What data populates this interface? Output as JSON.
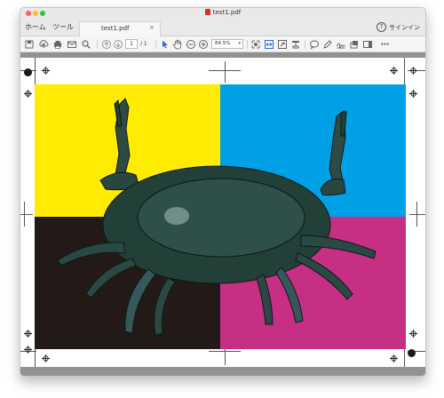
{
  "window": {
    "title": "test1.pdf"
  },
  "tabs": {
    "home": "ホーム",
    "tools": "ツール",
    "document": "test1.pdf",
    "close": "×"
  },
  "header": {
    "help": "?",
    "signin": "サインイン"
  },
  "toolbar": {
    "page_current": "1",
    "page_total": "/ 1",
    "zoom": "84.5%",
    "more": "•••",
    "icons": [
      "save-icon",
      "upload-icon",
      "print-icon",
      "mail-icon",
      "search-icon",
      "prev-page-icon",
      "next-page-icon",
      "pointer-icon",
      "hand-icon",
      "zoom-out-icon",
      "zoom-in-icon",
      "fit-page-icon",
      "fit-width-icon",
      "fullscreen-icon",
      "stamp-icon",
      "comment-icon",
      "pen-icon",
      "sign-icon",
      "share-icon",
      "panel-icon"
    ]
  },
  "document": {
    "quadrant_colors": {
      "top_left": "#ffec00",
      "top_right": "#00a0e6",
      "bottom_left": "#231a17",
      "bottom_right": "#c72f85"
    },
    "subject": "crab-image"
  }
}
